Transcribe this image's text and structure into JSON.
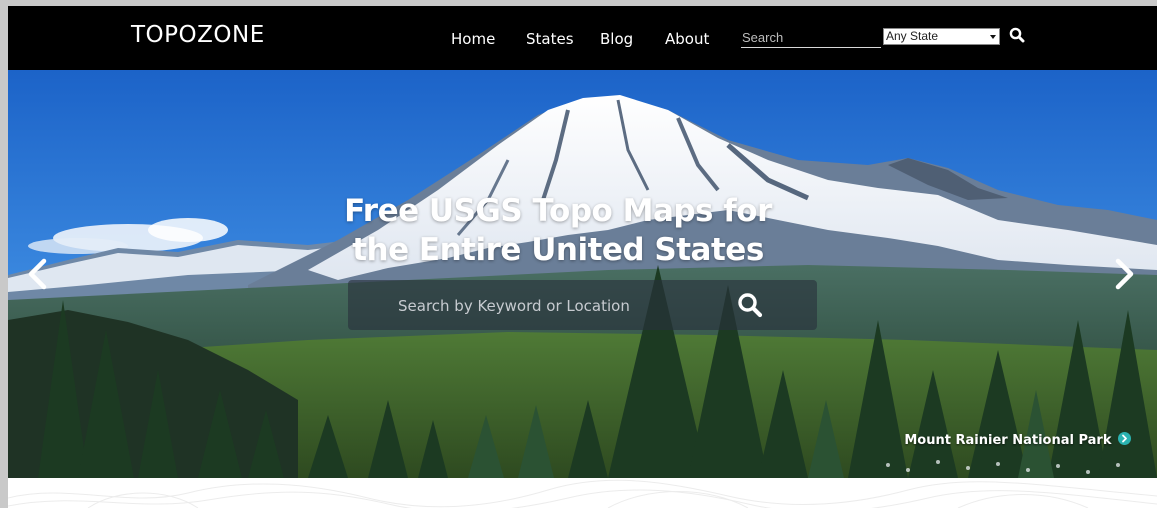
{
  "header": {
    "logo": "TOPOZONE",
    "nav": [
      "Home",
      "States",
      "Blog",
      "About"
    ],
    "search_placeholder": "Search",
    "state_select_value": "Any State"
  },
  "hero": {
    "title_line1": "Free USGS Topo Maps for",
    "title_line2": "the Entire United States",
    "search_placeholder": "Search by Keyword or Location",
    "caption": "Mount Rainier National Park"
  },
  "colors": {
    "navbar": "#000000",
    "accent_teal": "#2bb3b1",
    "sky": "#1f73d1"
  },
  "icons": {
    "nav_search": "search-icon",
    "hero_search": "search-icon",
    "prev": "chevron-left-icon",
    "next": "chevron-right-icon",
    "caption": "arrow-circle-right-icon"
  }
}
